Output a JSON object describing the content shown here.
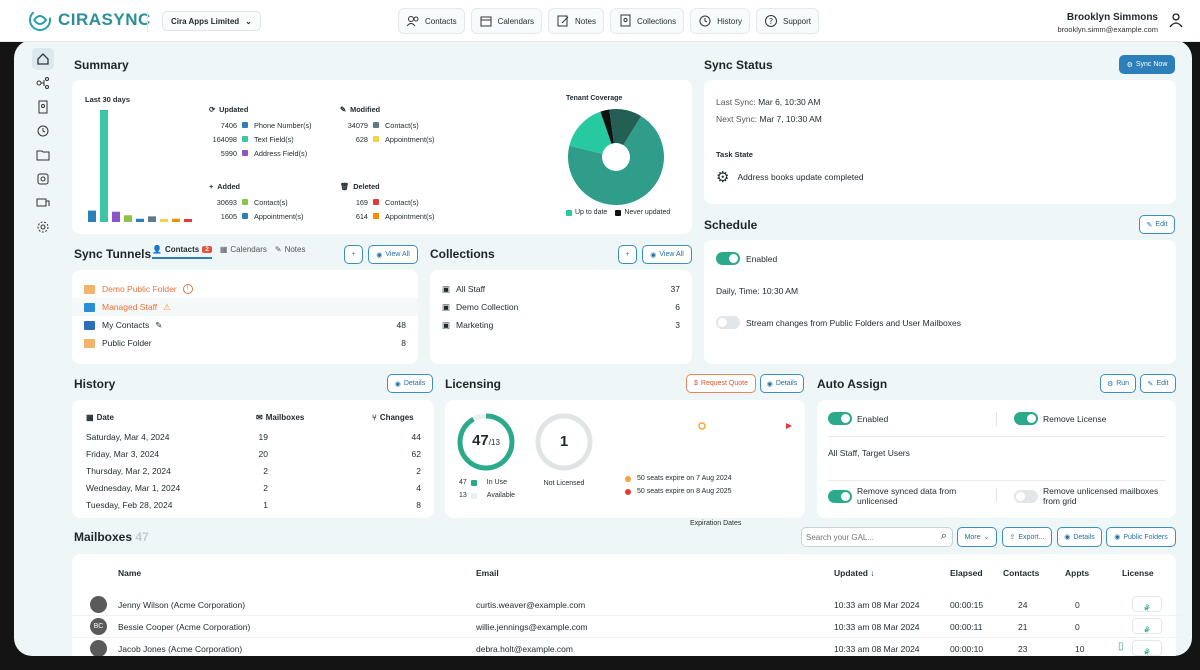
{
  "app": {
    "name": "CIRASYNC",
    "org": "Cira Apps Limited"
  },
  "nav": [
    "Contacts",
    "Calendars",
    "Notes",
    "Collections",
    "History",
    "Support"
  ],
  "user": {
    "name": "Brooklyn Simmons",
    "email": "brooklyn.simm@example.com"
  },
  "sidebar_icons": [
    "home-icon",
    "graph-icon",
    "contacts-book-icon",
    "history-icon",
    "folder-contacts-icon",
    "collections-icon",
    "license-icon",
    "settings-icon"
  ],
  "summary": {
    "title": "Summary",
    "period": "Last 30 days",
    "groups": [
      {
        "label": "Updated",
        "items": [
          {
            "num": "7406",
            "label": "Phone Number(s)",
            "color": "#2c7fb8"
          },
          {
            "num": "164098",
            "label": "Text Field(s)",
            "color": "#3cc4a4"
          },
          {
            "num": "5990",
            "label": "Address Field(s)",
            "color": "#8a55c9"
          }
        ]
      },
      {
        "label": "Modified",
        "items": [
          {
            "num": "34079",
            "label": "Contact(s)",
            "color": "#5d7a88"
          },
          {
            "num": "628",
            "label": "Appointment(s)",
            "color": "#f1d34a"
          }
        ]
      },
      {
        "label": "Added",
        "items": [
          {
            "num": "30693",
            "label": "Contact(s)",
            "color": "#8bc34a"
          },
          {
            "num": "1605",
            "label": "Appointment(s)",
            "color": "#2c7fb8"
          }
        ]
      },
      {
        "label": "Deleted",
        "items": [
          {
            "num": "169",
            "label": "Contact(s)",
            "color": "#e53935"
          },
          {
            "num": "614",
            "label": "Appointment(s)",
            "color": "#fb8c00"
          }
        ]
      }
    ],
    "bars": [
      {
        "value": 7406,
        "color": "#2c7fb8"
      },
      {
        "value": 164098,
        "color": "#3cc4a4"
      },
      {
        "value": 5990,
        "color": "#8a55c9"
      },
      {
        "value": 2600,
        "color": "#8bc34a"
      },
      {
        "value": 600,
        "color": "#2c7fb8"
      },
      {
        "value": 1800,
        "color": "#5d7a88"
      },
      {
        "value": 500,
        "color": "#f1d34a"
      },
      {
        "value": 600,
        "color": "#fb8c00"
      },
      {
        "value": 300,
        "color": "#e53935"
      }
    ],
    "coverage": {
      "title": "Tenant Coverage",
      "slices": [
        {
          "value": 70,
          "color": "#2f9d8a"
        },
        {
          "value": 16,
          "color": "#27c9a0"
        },
        {
          "value": 3,
          "color": "#111111"
        },
        {
          "value": 11,
          "color": "#245f56"
        }
      ],
      "legend": [
        {
          "label": "Up to date",
          "color": "#27c9a0"
        },
        {
          "label": "Never updated",
          "color": "#111111"
        }
      ]
    }
  },
  "sync_status": {
    "title": "Sync Status",
    "button": "Sync Now",
    "last_label": "Last Sync:",
    "last": "Mar 6, 10:30 AM",
    "next_label": "Next Sync:",
    "next": "Mar 7, 10:30 AM",
    "task_label": "Task State",
    "task": "Address books update completed"
  },
  "schedule": {
    "title": "Schedule",
    "edit": "Edit",
    "enabled": "Enabled",
    "time": "Daily, Time: 10:30 AM",
    "stream": "Stream changes from Public Folders and User Mailboxes"
  },
  "tunnels": {
    "title": "Sync Tunnels",
    "tabs": [
      {
        "label": "Contacts",
        "badge": "2"
      },
      {
        "label": "Calendars"
      },
      {
        "label": "Notes"
      }
    ],
    "view_all": "View All",
    "rows": [
      {
        "name": "Demo Public Folder",
        "count": "",
        "status": "error"
      },
      {
        "name": "Managed Staff",
        "count": "",
        "status": "warning"
      },
      {
        "name": "My Contacts",
        "count": "48",
        "status": "ok"
      },
      {
        "name": "Public Folder",
        "count": "8",
        "status": "ok"
      }
    ]
  },
  "collections": {
    "title": "Collections",
    "view_all": "View All",
    "rows": [
      {
        "name": "All Staff",
        "count": "37"
      },
      {
        "name": "Demo Collection",
        "count": "6"
      },
      {
        "name": "Marketing",
        "count": "3"
      }
    ]
  },
  "history": {
    "title": "History",
    "details": "Details",
    "headers": [
      "Date",
      "Mailboxes",
      "Changes"
    ],
    "rows": [
      {
        "date": "Saturday, Mar 4, 2024",
        "mailboxes": "19",
        "changes": "44"
      },
      {
        "date": "Friday, Mar 3, 2024",
        "mailboxes": "20",
        "changes": "62"
      },
      {
        "date": "Thursday, Mar 2, 2024",
        "mailboxes": "2",
        "changes": "2"
      },
      {
        "date": "Wednesday, Mar 1, 2024",
        "mailboxes": "2",
        "changes": "4"
      },
      {
        "date": "Tuesday, Feb 28, 2024",
        "mailboxes": "1",
        "changes": "8"
      }
    ]
  },
  "licensing": {
    "title": "Licensing",
    "quote": "Request Quote",
    "details": "Details",
    "used": "47",
    "total": "/13",
    "in_use_num": "47",
    "in_use": "In Use",
    "available_num": "13",
    "available": "Available",
    "not_licensed_num": "1",
    "not_licensed": "Not Licensed",
    "expiry": [
      {
        "text": "50 seats expire on 7 Aug 2024",
        "color": "#f4a23c"
      },
      {
        "text": "50 seats expire on 8 Aug 2025",
        "color": "#e53935"
      }
    ],
    "expiry_label": "Expiration Dates"
  },
  "auto_assign": {
    "title": "Auto Assign",
    "run": "Run",
    "edit": "Edit",
    "enabled": "Enabled",
    "remove_license": "Remove License",
    "targets": "All Staff, Target Users",
    "remove_synced": "Remove synced data from unlicensed",
    "remove_unlicensed": "Remove unlicensed mailboxes from grid"
  },
  "mailboxes": {
    "title": "Mailboxes",
    "count": "47",
    "search_placeholder": "Search your GAL...",
    "more": "More",
    "export": "Export...",
    "details": "Details",
    "public_folders": "Public Folders",
    "headers": [
      "Name",
      "Email",
      "Updated",
      "Elapsed",
      "Contacts",
      "Appts",
      "License"
    ],
    "rows": [
      {
        "initials": "",
        "name": "Jenny Wilson  (Acme Corporation)",
        "email": "curtis.weaver@example.com",
        "updated": "10:33 am 08 Mar 2024",
        "elapsed": "00:00:15",
        "contacts": "24",
        "appts": "0"
      },
      {
        "initials": "BC",
        "name": "Bessie Cooper  (Acme Corporation)",
        "email": "willie.jennings@example.com",
        "updated": "10:33 am 08 Mar 2024",
        "elapsed": "00:00:11",
        "contacts": "21",
        "appts": "0"
      },
      {
        "initials": "",
        "name": "Jacob Jones  (Acme Corporation)",
        "email": "debra.holt@example.com",
        "updated": "10:33 am 08 Mar 2024",
        "elapsed": "00:00:10",
        "contacts": "23",
        "appts": "10"
      }
    ]
  }
}
